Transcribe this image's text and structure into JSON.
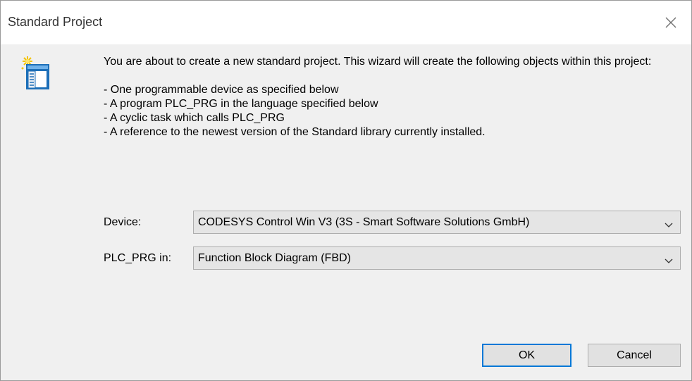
{
  "window": {
    "title": "Standard Project"
  },
  "icons": {
    "close": "close-icon",
    "wizard": "project-wizard-icon",
    "dropdown": "chevron-down-icon"
  },
  "intro": {
    "text": "You are about to create a new standard project. This wizard will create the following objects within this project:",
    "bullets": [
      "- One programmable device as specified below",
      "- A program PLC_PRG in the language specified below",
      "- A cyclic task which calls PLC_PRG",
      "- A reference to the newest version of the Standard library currently installed."
    ]
  },
  "form": {
    "device_label": "Device:",
    "device_value": "CODESYS Control Win V3 (3S - Smart Software Solutions GmbH)",
    "plc_label": "PLC_PRG in:",
    "plc_value": "Function Block Diagram (FBD)"
  },
  "buttons": {
    "ok": "OK",
    "cancel": "Cancel"
  },
  "colors": {
    "accent": "#0078d7",
    "dialog_bg": "#f0f0f0",
    "titlebar_bg": "#ffffff"
  }
}
